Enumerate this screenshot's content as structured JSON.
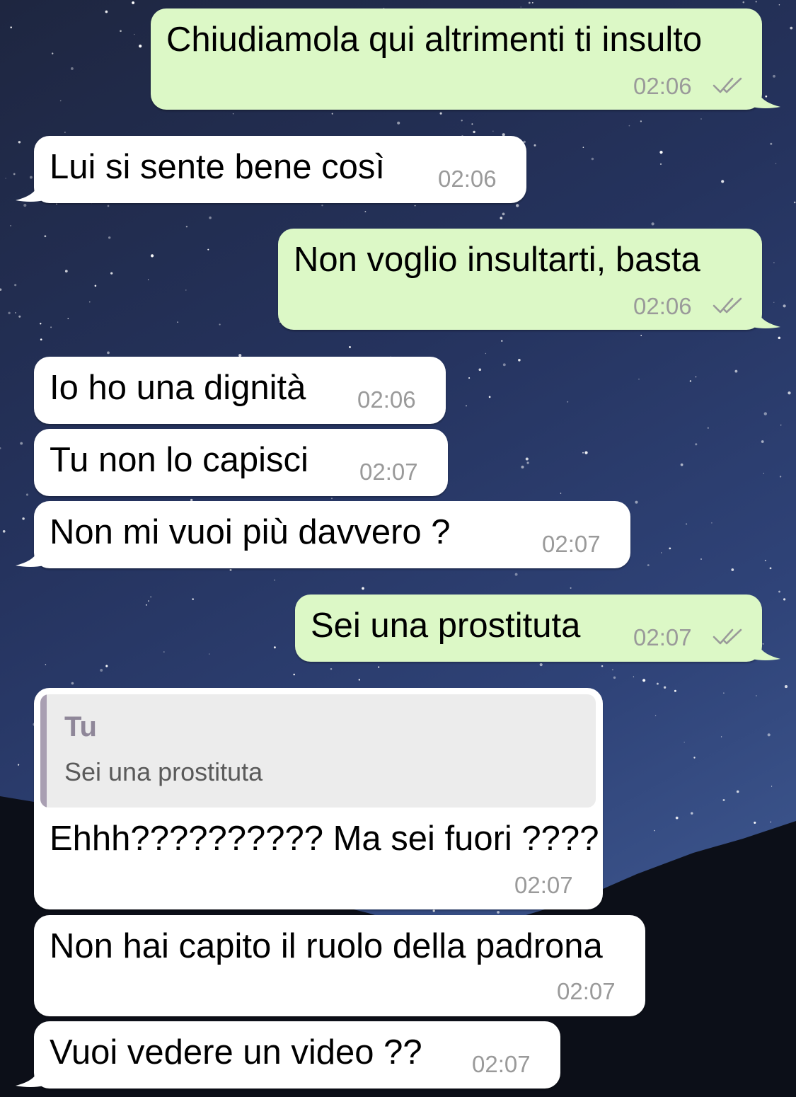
{
  "chat": {
    "outgoing_color": "#dcf8c6",
    "incoming_color": "#ffffff",
    "tick_color": "#9a9a9a",
    "messages": [
      {
        "direction": "outgoing",
        "text": "Chiudiamola qui altrimenti ti insulto",
        "time": "02:06",
        "status_icon": "double-check-icon"
      },
      {
        "direction": "incoming",
        "text": "Lui si sente bene così",
        "time": "02:06"
      },
      {
        "direction": "outgoing",
        "text": "Non voglio insultarti, basta",
        "time": "02:06",
        "status_icon": "double-check-icon"
      },
      {
        "direction": "incoming",
        "text": "Io ho una dignità",
        "time": "02:06"
      },
      {
        "direction": "incoming",
        "text": "Tu non lo capisci",
        "time": "02:07"
      },
      {
        "direction": "incoming",
        "text": "Non mi vuoi più davvero ?",
        "time": "02:07"
      },
      {
        "direction": "outgoing",
        "text": "Sei una prostituta",
        "time": "02:07",
        "status_icon": "double-check-icon"
      },
      {
        "direction": "incoming",
        "text": "Ehhh?????????? Ma sei fuori ????",
        "time": "02:07",
        "reply_to": {
          "author": "Tu",
          "text": "Sei una prostituta"
        }
      },
      {
        "direction": "incoming",
        "text": "Non hai capito il ruolo della padrona",
        "time": "02:07"
      },
      {
        "direction": "incoming",
        "text": "Vuoi vedere un video ??",
        "time": "02:07"
      }
    ]
  }
}
